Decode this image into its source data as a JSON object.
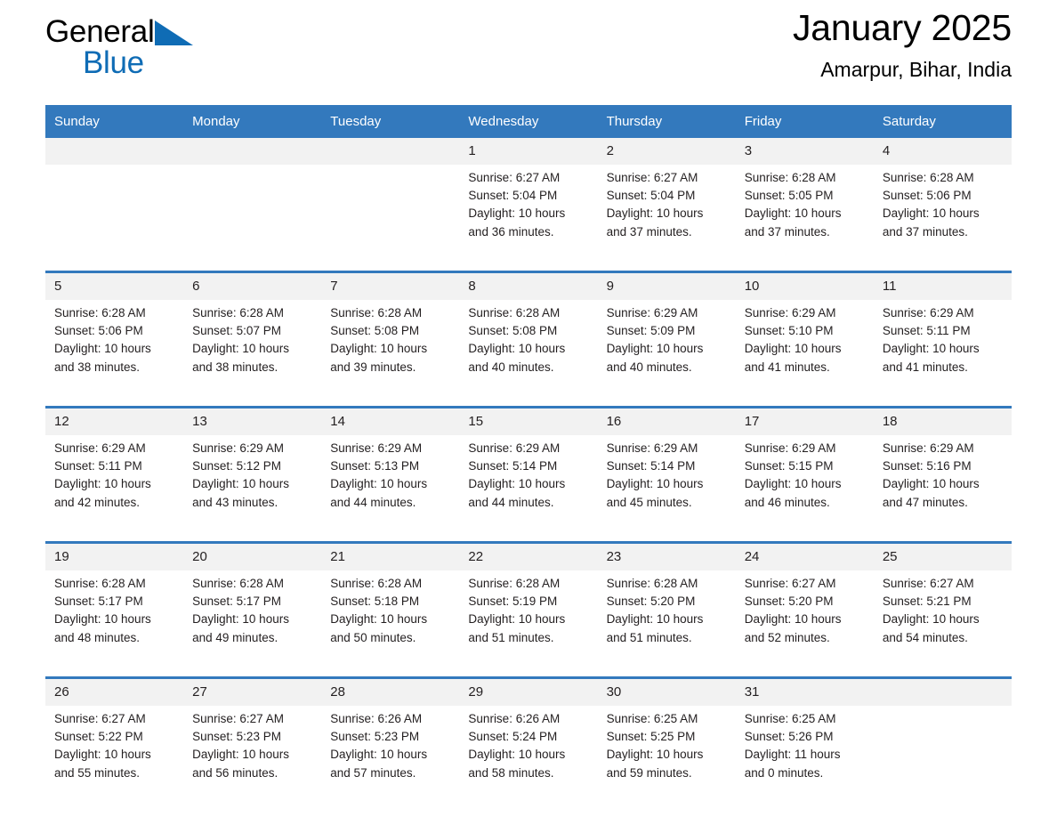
{
  "brand": {
    "name_top": "General",
    "name_bottom": "Blue",
    "triangle_color": "#0f6cb5",
    "text_color": "#000000",
    "blue_color": "#0f6cb5"
  },
  "header": {
    "title": "January 2025",
    "location": "Amarpur, Bihar, India"
  },
  "theme": {
    "header_bg": "#3379bd",
    "daynum_bg": "#f2f2f2",
    "row_rule": "#3379bd",
    "text": "#231f20"
  },
  "weekday_headers": [
    "Sunday",
    "Monday",
    "Tuesday",
    "Wednesday",
    "Thursday",
    "Friday",
    "Saturday"
  ],
  "weeks": [
    {
      "days": [
        {
          "num": "",
          "lines": [
            "",
            "",
            "",
            ""
          ]
        },
        {
          "num": "",
          "lines": [
            "",
            "",
            "",
            ""
          ]
        },
        {
          "num": "",
          "lines": [
            "",
            "",
            "",
            ""
          ]
        },
        {
          "num": "1",
          "lines": [
            "Sunrise: 6:27 AM",
            "Sunset: 5:04 PM",
            "Daylight: 10 hours",
            "and 36 minutes."
          ]
        },
        {
          "num": "2",
          "lines": [
            "Sunrise: 6:27 AM",
            "Sunset: 5:04 PM",
            "Daylight: 10 hours",
            "and 37 minutes."
          ]
        },
        {
          "num": "3",
          "lines": [
            "Sunrise: 6:28 AM",
            "Sunset: 5:05 PM",
            "Daylight: 10 hours",
            "and 37 minutes."
          ]
        },
        {
          "num": "4",
          "lines": [
            "Sunrise: 6:28 AM",
            "Sunset: 5:06 PM",
            "Daylight: 10 hours",
            "and 37 minutes."
          ]
        }
      ]
    },
    {
      "days": [
        {
          "num": "5",
          "lines": [
            "Sunrise: 6:28 AM",
            "Sunset: 5:06 PM",
            "Daylight: 10 hours",
            "and 38 minutes."
          ]
        },
        {
          "num": "6",
          "lines": [
            "Sunrise: 6:28 AM",
            "Sunset: 5:07 PM",
            "Daylight: 10 hours",
            "and 38 minutes."
          ]
        },
        {
          "num": "7",
          "lines": [
            "Sunrise: 6:28 AM",
            "Sunset: 5:08 PM",
            "Daylight: 10 hours",
            "and 39 minutes."
          ]
        },
        {
          "num": "8",
          "lines": [
            "Sunrise: 6:28 AM",
            "Sunset: 5:08 PM",
            "Daylight: 10 hours",
            "and 40 minutes."
          ]
        },
        {
          "num": "9",
          "lines": [
            "Sunrise: 6:29 AM",
            "Sunset: 5:09 PM",
            "Daylight: 10 hours",
            "and 40 minutes."
          ]
        },
        {
          "num": "10",
          "lines": [
            "Sunrise: 6:29 AM",
            "Sunset: 5:10 PM",
            "Daylight: 10 hours",
            "and 41 minutes."
          ]
        },
        {
          "num": "11",
          "lines": [
            "Sunrise: 6:29 AM",
            "Sunset: 5:11 PM",
            "Daylight: 10 hours",
            "and 41 minutes."
          ]
        }
      ]
    },
    {
      "days": [
        {
          "num": "12",
          "lines": [
            "Sunrise: 6:29 AM",
            "Sunset: 5:11 PM",
            "Daylight: 10 hours",
            "and 42 minutes."
          ]
        },
        {
          "num": "13",
          "lines": [
            "Sunrise: 6:29 AM",
            "Sunset: 5:12 PM",
            "Daylight: 10 hours",
            "and 43 minutes."
          ]
        },
        {
          "num": "14",
          "lines": [
            "Sunrise: 6:29 AM",
            "Sunset: 5:13 PM",
            "Daylight: 10 hours",
            "and 44 minutes."
          ]
        },
        {
          "num": "15",
          "lines": [
            "Sunrise: 6:29 AM",
            "Sunset: 5:14 PM",
            "Daylight: 10 hours",
            "and 44 minutes."
          ]
        },
        {
          "num": "16",
          "lines": [
            "Sunrise: 6:29 AM",
            "Sunset: 5:14 PM",
            "Daylight: 10 hours",
            "and 45 minutes."
          ]
        },
        {
          "num": "17",
          "lines": [
            "Sunrise: 6:29 AM",
            "Sunset: 5:15 PM",
            "Daylight: 10 hours",
            "and 46 minutes."
          ]
        },
        {
          "num": "18",
          "lines": [
            "Sunrise: 6:29 AM",
            "Sunset: 5:16 PM",
            "Daylight: 10 hours",
            "and 47 minutes."
          ]
        }
      ]
    },
    {
      "days": [
        {
          "num": "19",
          "lines": [
            "Sunrise: 6:28 AM",
            "Sunset: 5:17 PM",
            "Daylight: 10 hours",
            "and 48 minutes."
          ]
        },
        {
          "num": "20",
          "lines": [
            "Sunrise: 6:28 AM",
            "Sunset: 5:17 PM",
            "Daylight: 10 hours",
            "and 49 minutes."
          ]
        },
        {
          "num": "21",
          "lines": [
            "Sunrise: 6:28 AM",
            "Sunset: 5:18 PM",
            "Daylight: 10 hours",
            "and 50 minutes."
          ]
        },
        {
          "num": "22",
          "lines": [
            "Sunrise: 6:28 AM",
            "Sunset: 5:19 PM",
            "Daylight: 10 hours",
            "and 51 minutes."
          ]
        },
        {
          "num": "23",
          "lines": [
            "Sunrise: 6:28 AM",
            "Sunset: 5:20 PM",
            "Daylight: 10 hours",
            "and 51 minutes."
          ]
        },
        {
          "num": "24",
          "lines": [
            "Sunrise: 6:27 AM",
            "Sunset: 5:20 PM",
            "Daylight: 10 hours",
            "and 52 minutes."
          ]
        },
        {
          "num": "25",
          "lines": [
            "Sunrise: 6:27 AM",
            "Sunset: 5:21 PM",
            "Daylight: 10 hours",
            "and 54 minutes."
          ]
        }
      ]
    },
    {
      "days": [
        {
          "num": "26",
          "lines": [
            "Sunrise: 6:27 AM",
            "Sunset: 5:22 PM",
            "Daylight: 10 hours",
            "and 55 minutes."
          ]
        },
        {
          "num": "27",
          "lines": [
            "Sunrise: 6:27 AM",
            "Sunset: 5:23 PM",
            "Daylight: 10 hours",
            "and 56 minutes."
          ]
        },
        {
          "num": "28",
          "lines": [
            "Sunrise: 6:26 AM",
            "Sunset: 5:23 PM",
            "Daylight: 10 hours",
            "and 57 minutes."
          ]
        },
        {
          "num": "29",
          "lines": [
            "Sunrise: 6:26 AM",
            "Sunset: 5:24 PM",
            "Daylight: 10 hours",
            "and 58 minutes."
          ]
        },
        {
          "num": "30",
          "lines": [
            "Sunrise: 6:25 AM",
            "Sunset: 5:25 PM",
            "Daylight: 10 hours",
            "and 59 minutes."
          ]
        },
        {
          "num": "31",
          "lines": [
            "Sunrise: 6:25 AM",
            "Sunset: 5:26 PM",
            "Daylight: 11 hours",
            "and 0 minutes."
          ]
        },
        {
          "num": "",
          "lines": [
            "",
            "",
            "",
            ""
          ]
        }
      ]
    }
  ]
}
